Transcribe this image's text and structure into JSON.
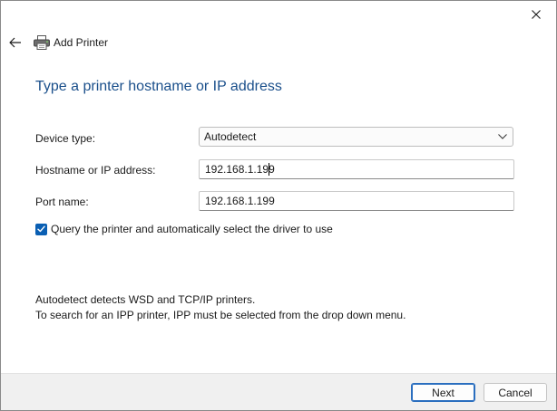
{
  "window": {
    "title": "Add Printer"
  },
  "heading": "Type a printer hostname or IP address",
  "form": {
    "device_type": {
      "label": "Device type:",
      "value": "Autodetect"
    },
    "hostname": {
      "label": "Hostname or IP address:",
      "value": "192.168.1.199"
    },
    "port_name": {
      "label": "Port name:",
      "value": "192.168.1.199"
    },
    "query_checkbox": {
      "label": "Query the printer and automatically select the driver to use",
      "checked": true
    }
  },
  "info": {
    "line1": "Autodetect detects WSD and TCP/IP printers.",
    "line2": "To search for an IPP printer, IPP must be selected from the drop down menu."
  },
  "buttons": {
    "next": "Next",
    "cancel": "Cancel"
  },
  "icons": {
    "close": "close-icon",
    "back": "back-arrow-icon",
    "printer": "printer-icon",
    "dropdown": "chevron-down-icon",
    "check": "checkmark-icon"
  },
  "colors": {
    "accent": "#0a5fb3",
    "heading": "#1a4f8b",
    "footer_bg": "#f0f0f0"
  }
}
